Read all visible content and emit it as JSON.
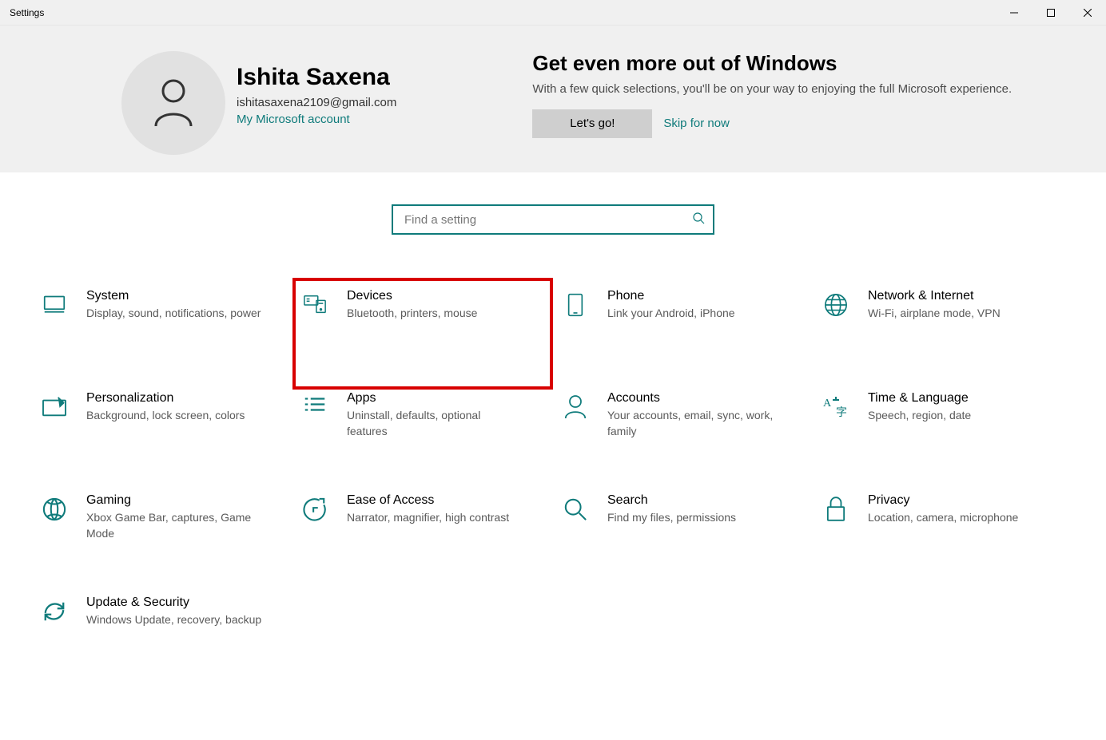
{
  "window": {
    "title": "Settings"
  },
  "user": {
    "name": "Ishita Saxena",
    "email": "ishitasaxena2109@gmail.com",
    "account_link": "My Microsoft account"
  },
  "promo": {
    "title": "Get even more out of Windows",
    "desc": "With a few quick selections, you'll be on your way to enjoying the full Microsoft experience.",
    "button": "Let's go!",
    "skip": "Skip for now"
  },
  "search": {
    "placeholder": "Find a setting"
  },
  "categories": [
    {
      "id": "system",
      "title": "System",
      "desc": "Display, sound, notifications, power"
    },
    {
      "id": "devices",
      "title": "Devices",
      "desc": "Bluetooth, printers, mouse",
      "highlighted": true
    },
    {
      "id": "phone",
      "title": "Phone",
      "desc": "Link your Android, iPhone"
    },
    {
      "id": "network",
      "title": "Network & Internet",
      "desc": "Wi-Fi, airplane mode, VPN"
    },
    {
      "id": "personalization",
      "title": "Personalization",
      "desc": "Background, lock screen, colors"
    },
    {
      "id": "apps",
      "title": "Apps",
      "desc": "Uninstall, defaults, optional features"
    },
    {
      "id": "accounts",
      "title": "Accounts",
      "desc": "Your accounts, email, sync, work, family"
    },
    {
      "id": "time",
      "title": "Time & Language",
      "desc": "Speech, region, date"
    },
    {
      "id": "gaming",
      "title": "Gaming",
      "desc": "Xbox Game Bar, captures, Game Mode"
    },
    {
      "id": "ease",
      "title": "Ease of Access",
      "desc": "Narrator, magnifier, high contrast"
    },
    {
      "id": "searchcat",
      "title": "Search",
      "desc": "Find my files, permissions"
    },
    {
      "id": "privacy",
      "title": "Privacy",
      "desc": "Location, camera, microphone"
    },
    {
      "id": "update",
      "title": "Update & Security",
      "desc": "Windows Update, recovery, backup"
    }
  ],
  "colors": {
    "accent": "#0f7b7b",
    "highlight": "#d80000"
  }
}
